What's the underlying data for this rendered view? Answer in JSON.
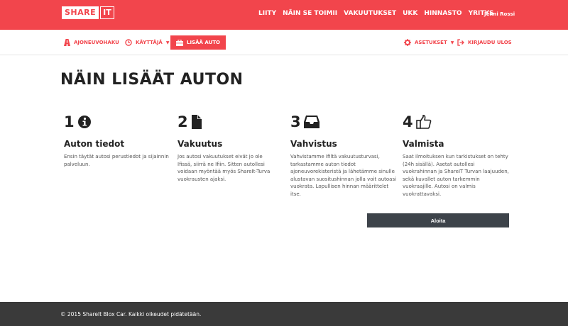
{
  "header": {
    "logo_share": "SHARE",
    "logo_it": "IT",
    "nav": [
      "LIITY",
      "NÄIN SE TOIMII",
      "VAKUUTUKSET",
      "UKK",
      "HINNASTO",
      "YRITYS"
    ],
    "user_name": "Jenni Rossi"
  },
  "subnav": {
    "vehicle_search": "AJONEUVOHAKU",
    "user": "KÄYTTÄJÄ",
    "add_car": "LISÄÄ AUTO",
    "settings": "ASETUKSET",
    "logout": "KIRJAUDU ULOS"
  },
  "main": {
    "title": "NÄIN LISÄÄT AUTON",
    "steps": [
      {
        "number": "1",
        "icon": "info-circle-icon",
        "title": "Auton tiedot",
        "text": "Ensin täytät autosi perustiedot ja sijainnin palveluun."
      },
      {
        "number": "2",
        "icon": "document-icon",
        "title": "Vakuutus",
        "text": "Jos autosi vakuutukset eivät jo ole Ifissä, siirrä ne Ifiin. Sitten autollesi voidaan myöntää myös ShareIt-Turva vuokrausten ajaksi."
      },
      {
        "number": "3",
        "icon": "inbox-icon",
        "title": "Vahvistus",
        "text": "Vahvistamme Ifiltä vakuutusturvasi, tarkastamme auton tiedot ajoneuvorekisteristä ja lähetämme sinulle alustavan suositushinnan jolla voit autoasi vuokrata. Lopullisen hinnan määrittelet itse."
      },
      {
        "number": "4",
        "icon": "thumbs-up-icon",
        "title": "Valmista",
        "text": "Saat ilmoituksen kun tarkistukset on tehty (24h sisällä). Asetat autollesi vuokrahinnan ja ShareIT Turvan laajuuden, sekä kuvallet auton tarkemmin vuokraajille. Autosi on valmis vuokrattavaksi."
      }
    ],
    "start_button": "Aloita"
  },
  "footer": {
    "copyright": "© 2015 ShareIt Blox Car. Kaikki oikeudet pidätetään."
  },
  "colors": {
    "brand_red": "#f2454c",
    "button_dark": "#3d434a",
    "footer_bg": "#3a3a3a"
  }
}
